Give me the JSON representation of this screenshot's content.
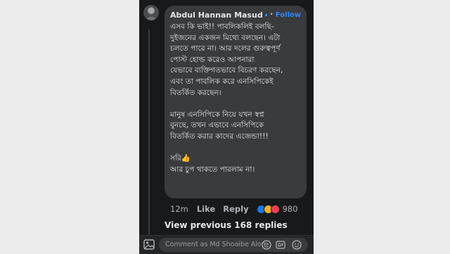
{
  "comment": {
    "author": "Abdul Hannan Masud",
    "separator": "•",
    "follow_label": "Follow",
    "text": "এসব কি ভাই!! পাবলিকলিই বলছি-\nদুইজনের একজন মিথ্যে বলছেন। এটা\nচলতে পারে না। আর দলের গুরুত্বপূর্ণ\nপোস্ট হোল্ড করেও আপনারা\nযেভাবে ব্যক্তিগতভাবে বিচরণ করছেন,\nএবং তা পাবলিক করে এনসিপিকেই\nবিতর্কিত করছেন।\n\nমানুষ এনসিপিকে নিয়ে যখন স্বপ্ন\nবুনছে, তখন এভাবে এনসিপিকে\nবিতর্কিত করার কাদের এজেন্ডা!!!\n\nসরি👍\nআর চুপ থাকতে পারলাম না।",
    "time": "12m",
    "like_label": "Like",
    "reply_label": "Reply",
    "reaction_count": "980",
    "reactions": [
      "like-reaction-icon",
      "haha-reaction-icon",
      "love-reaction-icon"
    ]
  },
  "thread": {
    "view_previous_label": "View previous 168 replies"
  },
  "composer": {
    "placeholder": "Comment as Md Shoaibe Alom",
    "icons": [
      "camera-icon",
      "avatar-sticker-icon",
      "gif-icon",
      "emoji-icon"
    ]
  },
  "colors": {
    "panel_bg": "#18191a",
    "bubble_bg": "#3a3b3c",
    "text_primary": "#e4e6eb",
    "text_secondary": "#b0b3b8",
    "accent": "#2d88ff"
  }
}
